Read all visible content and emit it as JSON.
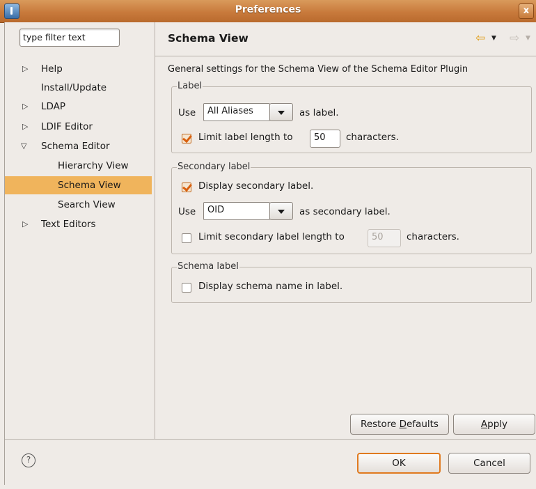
{
  "window": {
    "title": "Preferences",
    "close_label": "x"
  },
  "filter": {
    "value": "type filter text"
  },
  "tree": [
    {
      "label": "Help",
      "expander": "collapsed"
    },
    {
      "label": "Install/Update",
      "expander": "none"
    },
    {
      "label": "LDAP",
      "expander": "collapsed"
    },
    {
      "label": "LDIF Editor",
      "expander": "collapsed"
    },
    {
      "label": "Schema Editor",
      "expander": "expanded"
    },
    {
      "label": "Hierarchy View",
      "expander": "none"
    },
    {
      "label": "Schema View",
      "expander": "none",
      "selected": true
    },
    {
      "label": "Search View",
      "expander": "none"
    },
    {
      "label": "Text Editors",
      "expander": "collapsed"
    }
  ],
  "page": {
    "title": "Schema View",
    "description": "General settings for the Schema View of the Schema Editor Plugin"
  },
  "label_group": {
    "title": "Label",
    "use_prefix": "Use",
    "combo_value": "All Aliases",
    "use_suffix": "as label.",
    "limit_checked": true,
    "limit_label": "Limit label length to",
    "limit_value": "50",
    "limit_suffix": "characters."
  },
  "secondary_group": {
    "title": "Secondary label",
    "display_checked": true,
    "display_label": "Display secondary label.",
    "use_prefix": "Use",
    "combo_value": "OID",
    "use_suffix": "as secondary label.",
    "limit_checked": false,
    "limit_label": "Limit secondary label length to",
    "limit_value": "50",
    "limit_suffix": "characters."
  },
  "schema_group": {
    "title": "Schema label",
    "display_checked": false,
    "display_label": "Display schema name in label."
  },
  "buttons": {
    "restore_pre": "Restore ",
    "restore_mnemonic": "D",
    "restore_post": "efaults",
    "apply_mnemonic": "A",
    "apply_post": "pply",
    "ok": "OK",
    "cancel": "Cancel"
  },
  "colors": {
    "accent": "#e07a1f",
    "selection": "#f0b45c",
    "titlebar": "#c87a3c"
  }
}
